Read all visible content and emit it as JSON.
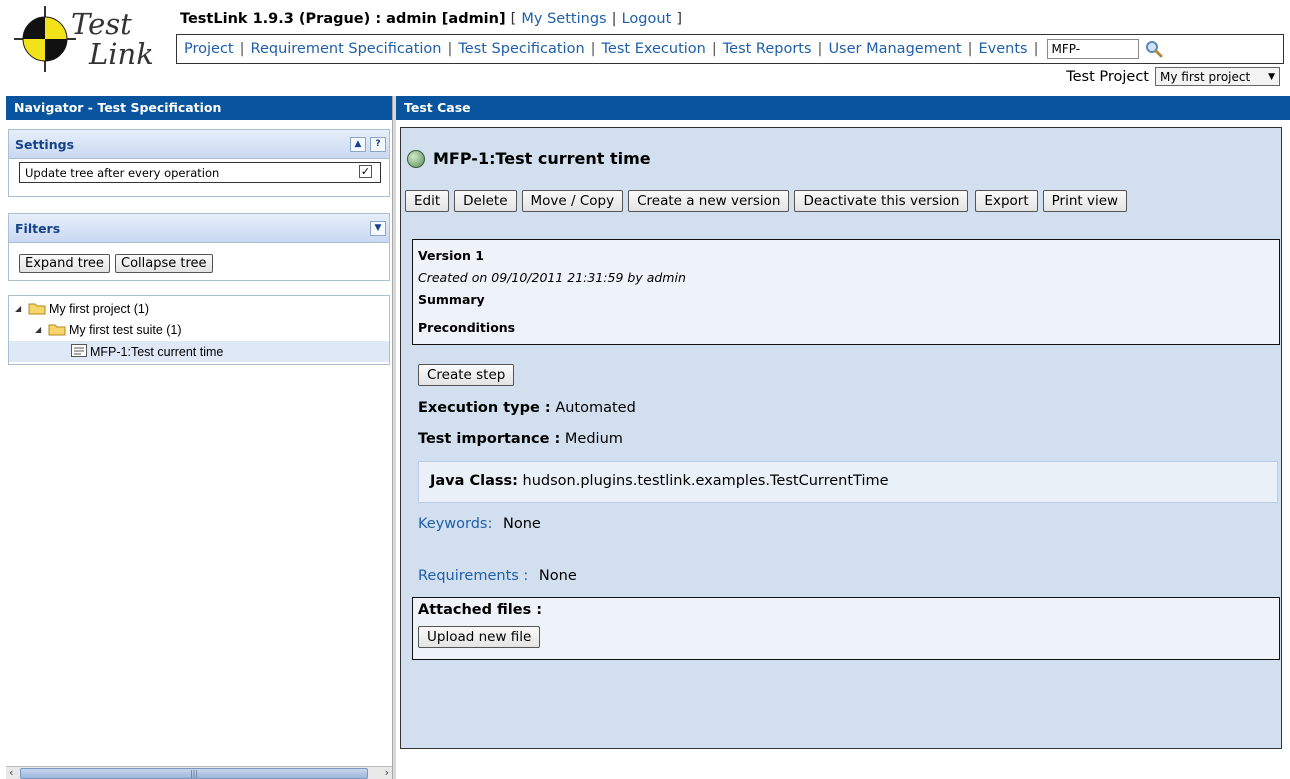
{
  "logo": {
    "word1": "Test",
    "word2": "Link"
  },
  "header": {
    "title": "TestLink 1.9.3 (Prague) : admin [admin]",
    "my_settings": "My Settings",
    "logout": "Logout",
    "menu": [
      "Project",
      "Requirement Specification",
      "Test Specification",
      "Test Execution",
      "Test Reports",
      "User Management",
      "Events"
    ],
    "search_value": "MFP-",
    "project_label": "Test Project",
    "project_selected": "My first project"
  },
  "navigator": {
    "title": "Navigator - Test Specification",
    "settings_title": "Settings",
    "setting_update_tree": "Update tree after every operation",
    "filters_title": "Filters",
    "expand_tree": "Expand tree",
    "collapse_tree": "Collapse tree",
    "tree": [
      {
        "label": "My first project (1)",
        "level": 0,
        "type": "folder"
      },
      {
        "label": "My first test suite (1)",
        "level": 1,
        "type": "folder"
      },
      {
        "label": "MFP-1:Test current time",
        "level": 2,
        "type": "testcase",
        "selected": true
      }
    ]
  },
  "testcase": {
    "panel_title": "Test Case",
    "heading": "MFP-1:Test current time",
    "actions": [
      "Edit",
      "Delete",
      "Move / Copy",
      "Create a new version",
      "Deactivate this version",
      "Export",
      "Print view"
    ],
    "version_label": "Version 1",
    "created": "Created on 09/10/2011 21:31:59  by admin",
    "summary_label": "Summary",
    "preconditions_label": "Preconditions",
    "create_step": "Create step",
    "execution_type_label": "Execution type :",
    "execution_type_value": "Automated",
    "importance_label": "Test importance :",
    "importance_value": "Medium",
    "java_class_label": "Java Class:",
    "java_class_value": "hudson.plugins.testlink.examples.TestCurrentTime",
    "keywords_label": "Keywords:",
    "keywords_value": "None",
    "requirements_label": "Requirements :",
    "requirements_value": "None",
    "attached_files_label": "Attached files :",
    "upload_new_file": "Upload new file"
  },
  "colors": {
    "header_bar": "#08549e",
    "work_bg": "#d1dfee",
    "link": "#1f5fa8"
  }
}
